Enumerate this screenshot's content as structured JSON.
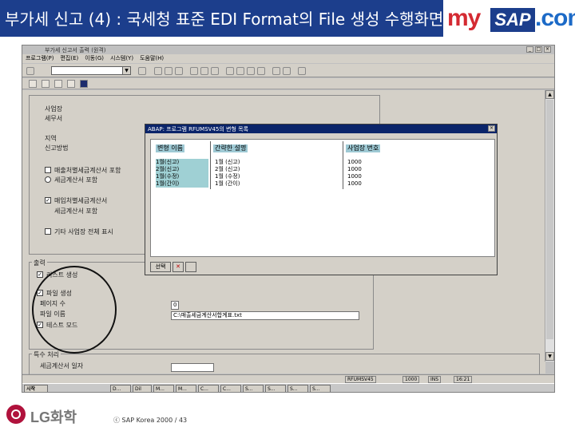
{
  "slide": {
    "title": "부가세 신고 (4) : 국세청 표준 EDI Format의 File 생성 수행화면",
    "logo_my": "my",
    "logo_sap": "SAP",
    "logo_dotcom": ".com",
    "footer_company": "LG화학",
    "copyright": "ⓒ SAP Korea 2000 / 43"
  },
  "window": {
    "title": "부가세 신고서 출력 (원격)",
    "menu": [
      "프로그램(P)",
      "편집(E)",
      "이동(G)",
      "시스템(Y)",
      "도움말(H)"
    ],
    "popup": {
      "title": "ABAP: 프로그램 RFUMSV45의 변형 목록",
      "headers": [
        "변형 이름",
        "간략한 설명",
        "사업장 번호"
      ],
      "rows": [
        [
          "1월(신고)",
          "1월 (신고)",
          "1000"
        ],
        [
          "2월(신고)",
          "2월 (신고)",
          "1000"
        ],
        [
          "1월(수정)",
          "1월 (수정)",
          "1000"
        ],
        [
          "1월(간이)",
          "1월 (간이)",
          "1000"
        ]
      ],
      "foot_btn": "선택"
    },
    "left_labels": {
      "biz_place": "사업장",
      "tax_office": "세무서",
      "area": "지역",
      "report": "신고방법",
      "sales": "매출처별세금계산서 포함",
      "sales2": "세금계산서 포함",
      "purchase": "매입처별세금계산서",
      "purchase2": "세금계산서 포함",
      "other": "기타 사업장 전체 표시"
    },
    "output": {
      "group_label": "출력",
      "list_gen": "리스트 생성",
      "file_gen": "파일 생성",
      "pages": "페이지 수",
      "filename": "파일 이름",
      "test": "테스트 모드",
      "page_value": "0",
      "file_value": "C:\\매출세금계산서합계표.txt"
    },
    "special": {
      "group_label": "특수 처리",
      "date_label": "세금계산서 일자"
    },
    "status": [
      "RFUMSV45",
      "1000",
      "INS",
      "16:21"
    ],
    "tasks": [
      "시작",
      "D...",
      "Dil",
      "M...",
      "M...",
      "C...",
      "C...",
      "S...",
      "S...",
      "S...",
      "S..."
    ]
  }
}
